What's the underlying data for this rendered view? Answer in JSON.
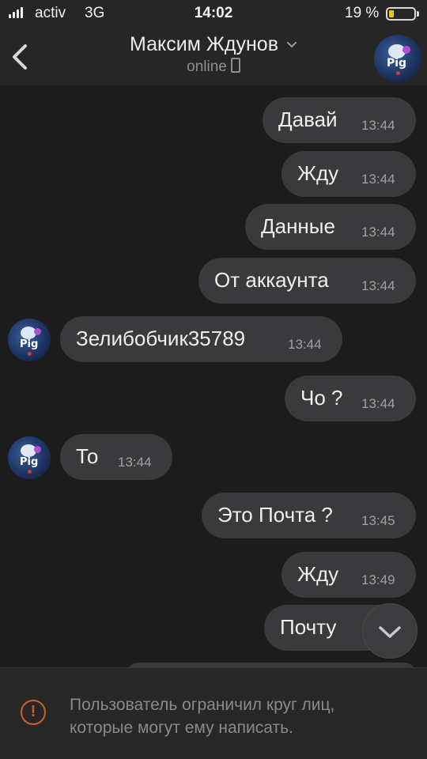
{
  "status_bar": {
    "carrier": "activ",
    "network": "3G",
    "time": "14:02",
    "battery_percent": "19 %",
    "battery_level": 0.19,
    "battery_color": "#f3c400"
  },
  "header": {
    "back_icon": "chevron-left-icon",
    "contact_name": "Максим Ждунов",
    "dropdown_icon": "chevron-down-icon",
    "status": "online",
    "status_icon": "phone-icon",
    "avatar_text": "Pig"
  },
  "messages": [
    {
      "direction": "out",
      "text": "Давай",
      "time": "13:44"
    },
    {
      "direction": "out",
      "text": "Жду",
      "time": "13:44"
    },
    {
      "direction": "out",
      "text": "Данные",
      "time": "13:44"
    },
    {
      "direction": "out",
      "text": "От аккаунта",
      "time": "13:44"
    },
    {
      "direction": "in",
      "text": "Зелибобчик35789",
      "time": "13:44"
    },
    {
      "direction": "out",
      "text": "Чо ?",
      "time": "13:44"
    },
    {
      "direction": "in",
      "text": "То",
      "time": "13:44"
    },
    {
      "direction": "out",
      "text": "Это Почта ?",
      "time": "13:45"
    },
    {
      "direction": "out",
      "text": "Жду",
      "time": "13:49"
    },
    {
      "direction": "out",
      "text": "Почту",
      "time": ""
    }
  ],
  "scroll_button_icon": "chevron-down-icon",
  "footer": {
    "warning_icon": "exclamation-circle-icon",
    "restriction_line1": "Пользователь ограничил круг лиц,",
    "restriction_line2": "которые могут ему написать.",
    "warning_color": "#c8622a"
  },
  "colors": {
    "background": "#1c1c1d",
    "bubble": "#3a3a3c",
    "header": "#262627"
  }
}
